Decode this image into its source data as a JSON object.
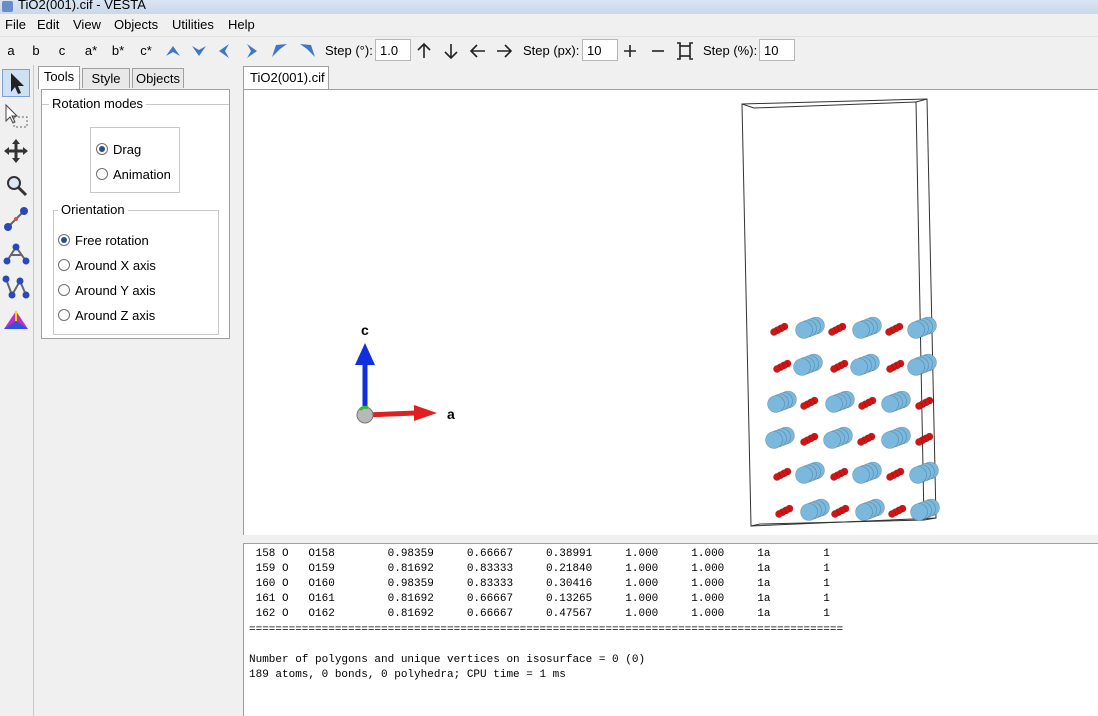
{
  "window": {
    "title": "TiO2(001).cif - VESTA"
  },
  "menu": [
    "File",
    "Edit",
    "View",
    "Objects",
    "Utilities",
    "Help"
  ],
  "toolbar": {
    "axis_buttons": [
      "a",
      "b",
      "c",
      "a*",
      "b*",
      "c*"
    ],
    "step_deg_label": "Step (°):",
    "step_deg_value": "1.0",
    "step_px_label": "Step (px):",
    "step_px_value": "10",
    "step_pct_label": "Step (%):",
    "step_pct_value": "10"
  },
  "panel": {
    "tabs": [
      "Tools",
      "Style",
      "Objects"
    ],
    "active_tab": "Tools",
    "rotation_modes": {
      "title": "Rotation modes",
      "options": [
        "Drag",
        "Animation"
      ],
      "selected": "Drag"
    },
    "orientation": {
      "title": "Orientation",
      "options": [
        "Free rotation",
        "Around X axis",
        "Around Y axis",
        "Around Z axis"
      ],
      "selected": "Free rotation"
    }
  },
  "document": {
    "tab": "TiO2(001).cif"
  },
  "axes": {
    "c_label": "c",
    "a_label": "a",
    "colors": {
      "a": "#e02020",
      "c": "#1030e0",
      "b": "#30c030"
    }
  },
  "atom_colors": {
    "Ti": "#7ab8de",
    "O": "#d41414"
  },
  "console": {
    "rows": [
      [
        "158",
        "O",
        "O158",
        "0.98359",
        "0.66667",
        "0.38991",
        "1.000",
        "1.000",
        "1a",
        "1"
      ],
      [
        "159",
        "O",
        "O159",
        "0.81692",
        "0.83333",
        "0.21840",
        "1.000",
        "1.000",
        "1a",
        "1"
      ],
      [
        "160",
        "O",
        "O160",
        "0.98359",
        "0.83333",
        "0.30416",
        "1.000",
        "1.000",
        "1a",
        "1"
      ],
      [
        "161",
        "O",
        "O161",
        "0.81692",
        "0.66667",
        "0.13265",
        "1.000",
        "1.000",
        "1a",
        "1"
      ],
      [
        "162",
        "O",
        "O162",
        "0.81692",
        "0.66667",
        "0.47567",
        "1.000",
        "1.000",
        "1a",
        "1"
      ]
    ],
    "separator": "==========================================================================================",
    "summary_line1": "Number of polygons and unique vertices on isosurface = 0 (0)",
    "summary_line2": "189 atoms, 0 bonds, 0 polyhedra; CPU time = 1 ms"
  }
}
